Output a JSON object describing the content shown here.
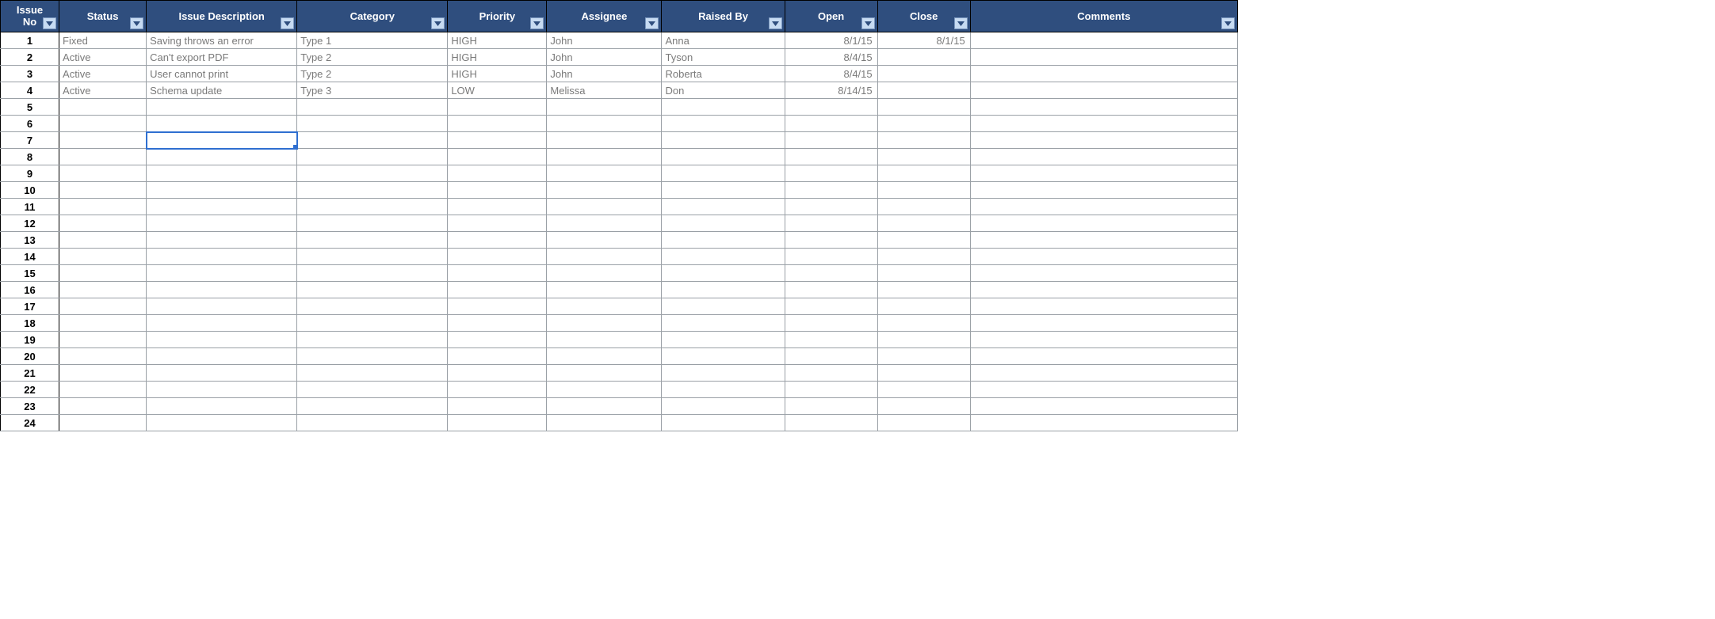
{
  "columns": [
    {
      "key": "issue_no",
      "label": "Issue\nNo",
      "cls": "col-issue-no"
    },
    {
      "key": "status",
      "label": "Status",
      "cls": "col-status"
    },
    {
      "key": "desc",
      "label": "Issue Description",
      "cls": "col-desc"
    },
    {
      "key": "category",
      "label": "Category",
      "cls": "col-category"
    },
    {
      "key": "priority",
      "label": "Priority",
      "cls": "col-priority"
    },
    {
      "key": "assignee",
      "label": "Assignee",
      "cls": "col-assignee"
    },
    {
      "key": "raised_by",
      "label": "Raised By",
      "cls": "col-raisedby"
    },
    {
      "key": "open",
      "label": "Open",
      "cls": "col-open"
    },
    {
      "key": "close",
      "label": "Close",
      "cls": "col-close"
    },
    {
      "key": "comments",
      "label": "Comments",
      "cls": "col-comments"
    }
  ],
  "rows": [
    {
      "issue_no": "1",
      "status": "Fixed",
      "desc": "Saving throws an error",
      "category": "Type 1",
      "priority": "HIGH",
      "assignee": "John",
      "raised_by": "Anna",
      "open": "8/1/15",
      "close": "8/1/15",
      "comments": ""
    },
    {
      "issue_no": "2",
      "status": "Active",
      "desc": "Can't export PDF",
      "category": "Type 2",
      "priority": "HIGH",
      "assignee": "John",
      "raised_by": "Tyson",
      "open": "8/4/15",
      "close": "",
      "comments": ""
    },
    {
      "issue_no": "3",
      "status": "Active",
      "desc": "User cannot print",
      "category": "Type 2",
      "priority": "HIGH",
      "assignee": "John",
      "raised_by": "Roberta",
      "open": "8/4/15",
      "close": "",
      "comments": ""
    },
    {
      "issue_no": "4",
      "status": "Active",
      "desc": "Schema update",
      "category": "Type 3",
      "priority": "LOW",
      "assignee": "Melissa",
      "raised_by": "Don",
      "open": "8/14/15",
      "close": "",
      "comments": ""
    },
    {
      "issue_no": "5"
    },
    {
      "issue_no": "6"
    },
    {
      "issue_no": "7"
    },
    {
      "issue_no": "8"
    },
    {
      "issue_no": "9"
    },
    {
      "issue_no": "10"
    },
    {
      "issue_no": "11"
    },
    {
      "issue_no": "12"
    },
    {
      "issue_no": "13"
    },
    {
      "issue_no": "14"
    },
    {
      "issue_no": "15"
    },
    {
      "issue_no": "16"
    },
    {
      "issue_no": "17"
    },
    {
      "issue_no": "18"
    },
    {
      "issue_no": "19"
    },
    {
      "issue_no": "20"
    },
    {
      "issue_no": "21"
    },
    {
      "issue_no": "22"
    },
    {
      "issue_no": "23"
    },
    {
      "issue_no": "24"
    }
  ],
  "selected": {
    "row_index": 6,
    "col_key": "desc"
  }
}
